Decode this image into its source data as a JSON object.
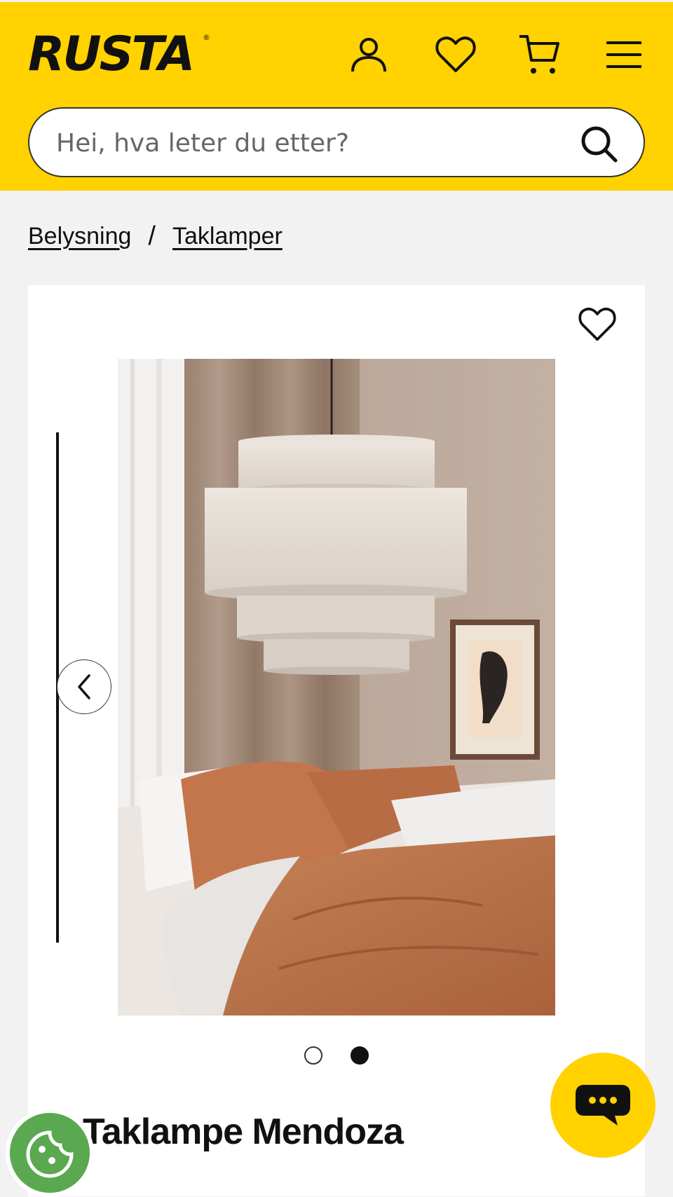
{
  "header": {
    "logo_text": "RUSTA",
    "logo_reg": "®",
    "icons": [
      "user-icon",
      "heart-icon",
      "cart-icon",
      "menu-icon"
    ],
    "brand_color": "#ffd200"
  },
  "search": {
    "placeholder": "Hei, hva leter du etter?",
    "value": ""
  },
  "breadcrumb": {
    "items": [
      "Belysning",
      "Taklamper"
    ],
    "separator": "/"
  },
  "product": {
    "title": "Taklampe Mendoza",
    "gallery_dots": 2,
    "active_dot": 2
  },
  "widgets": {
    "chat_icon": "chat-bubble-icon",
    "cookie_icon": "cookie-icon"
  }
}
